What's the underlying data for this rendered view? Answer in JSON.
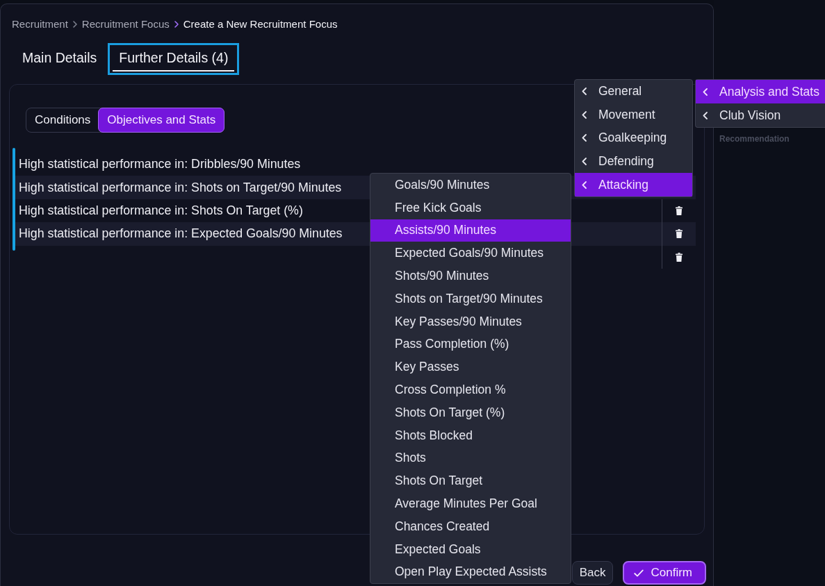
{
  "breadcrumb": [
    {
      "label": "Recruitment",
      "current": false
    },
    {
      "label": "Recruitment Focus",
      "current": false
    },
    {
      "label": "Create a New Recruitment Focus",
      "current": true
    }
  ],
  "tabs": [
    {
      "label": "Main Details",
      "selected": false,
      "focused": false
    },
    {
      "label": "Further Details (4)",
      "selected": true,
      "focused": true
    }
  ],
  "segments": [
    {
      "label": "Conditions",
      "selected": false
    },
    {
      "label": "Objectives and Stats",
      "selected": true
    }
  ],
  "objectives": [
    "High statistical performance in: Dribbles/90 Minutes",
    "High statistical performance in: Shots on Target/90 Minutes",
    "High statistical performance in: Shots On Target (%)",
    "High statistical performance in: Expected Goals/90 Minutes"
  ],
  "buttons": [
    {
      "label": "Back",
      "kind": "secondary"
    },
    {
      "label": "Confirm",
      "kind": "primary"
    }
  ],
  "side_panel": {
    "heading": "Recommendation"
  },
  "menus": [
    {
      "kind": "options",
      "items": [
        {
          "label": "Goals/90 Minutes",
          "selected": false
        },
        {
          "label": "Free Kick Goals",
          "selected": false
        },
        {
          "label": "Assists/90 Minutes",
          "selected": true
        },
        {
          "label": "Expected Goals/90 Minutes",
          "selected": false
        },
        {
          "label": "Shots/90 Minutes",
          "selected": false
        },
        {
          "label": "Shots on Target/90 Minutes",
          "selected": false
        },
        {
          "label": "Key Passes/90 Minutes",
          "selected": false
        },
        {
          "label": "Pass Completion (%)",
          "selected": false
        },
        {
          "label": "Key Passes",
          "selected": false
        },
        {
          "label": "Cross Completion %",
          "selected": false
        },
        {
          "label": "Shots On Target (%)",
          "selected": false
        },
        {
          "label": "Shots Blocked",
          "selected": false
        },
        {
          "label": "Shots",
          "selected": false
        },
        {
          "label": "Shots On Target",
          "selected": false
        },
        {
          "label": "Average Minutes Per Goal",
          "selected": false
        },
        {
          "label": "Chances Created",
          "selected": false
        },
        {
          "label": "Expected Goals",
          "selected": false
        },
        {
          "label": "Open Play Expected Assists",
          "selected": false
        }
      ]
    },
    {
      "kind": "submenu",
      "items": [
        {
          "label": "General",
          "selected": false
        },
        {
          "label": "Movement",
          "selected": false
        },
        {
          "label": "Goalkeeping",
          "selected": false
        },
        {
          "label": "Defending",
          "selected": false
        },
        {
          "label": "Attacking",
          "selected": true
        }
      ]
    },
    {
      "kind": "submenu",
      "items": [
        {
          "label": "Analysis and Stats",
          "selected": true
        },
        {
          "label": "Club Vision",
          "selected": false
        }
      ]
    }
  ]
}
